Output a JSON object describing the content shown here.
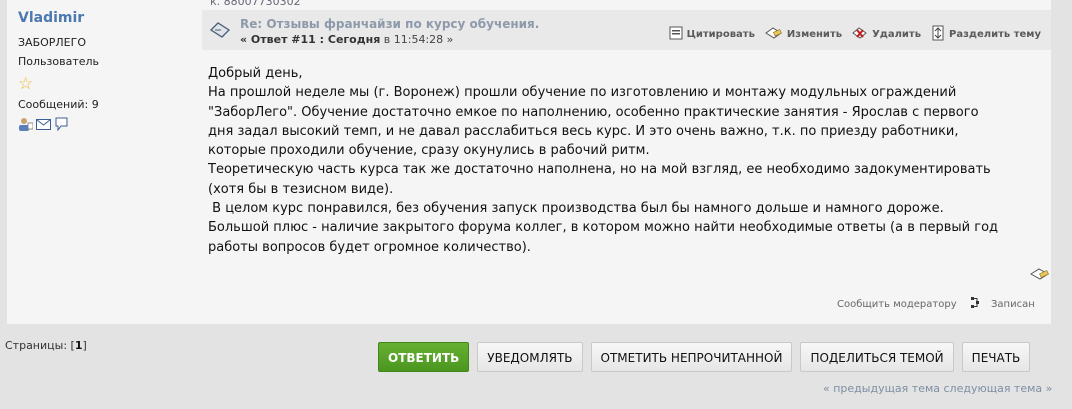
{
  "poster": {
    "name": "Vladimir",
    "group": "ЗАБОРЛЕГО",
    "role": "Пользователь",
    "posts_label": "Сообщений: 9",
    "star_icon": "star-icon",
    "profile_icons": [
      "profile-icon",
      "email-icon",
      "pm-icon"
    ]
  },
  "cut_text": "к. 88007730302",
  "post": {
    "title": "Re: Отзывы франчайзи по курсу обучения.",
    "meta_prefix": "« Ответ #11 : Сегодня",
    "meta_time": " в 11:54:28 »",
    "actions": {
      "quote": "Цитировать",
      "modify": "Изменить",
      "delete": "Удалить",
      "split": "Разделить тему"
    },
    "body": "Добрый день,\nНа прошлой неделе мы (г. Воронеж) прошли обучение по изготовлению и монтажу модульных ограждений\n\"ЗаборЛего\". Обучение достаточно емкое по наполнению, особенно практические занятия - Ярослав с первого\nдня задал высокий темп, и не давал расслабиться весь курс. И это очень важно, т.к. по приезду работники,\nкоторые проходили обучение, сразу окунулись в рабочий ритм.\nТеоретическую часть курса так же достаточно наполнена, но на мой взгляд, ее необходимо задокументировать\n(хотя бы в тезисном виде).\n В целом курс понравился, без обучения запуск производства был бы намного дольше и намного дороже.\nБольшой плюс - наличие закрытого форума коллег, в котором можно найти необходимые ответы (а в первый год\nработы вопросов будет огромное количество).",
    "report": "Сообщить модератору",
    "logged": "Записан"
  },
  "pages": {
    "label": "Страницы: [",
    "current": "1",
    "close": "]"
  },
  "buttons": {
    "reply": "ОТВЕТИТЬ",
    "notify": "УВЕДОМЛЯТЬ",
    "mark_unread": "ОТМЕТИТЬ НЕПРОЧИТАННОЙ",
    "share": "ПОДЕЛИТЬСЯ ТЕМОЙ",
    "print": "ПЕЧАТЬ"
  },
  "topic_nav": "« предыдущая тема следующая тема »",
  "colors": {
    "accent": "#4b79b0",
    "reply_button": "#4a961f",
    "background": "#e3e3e3"
  }
}
